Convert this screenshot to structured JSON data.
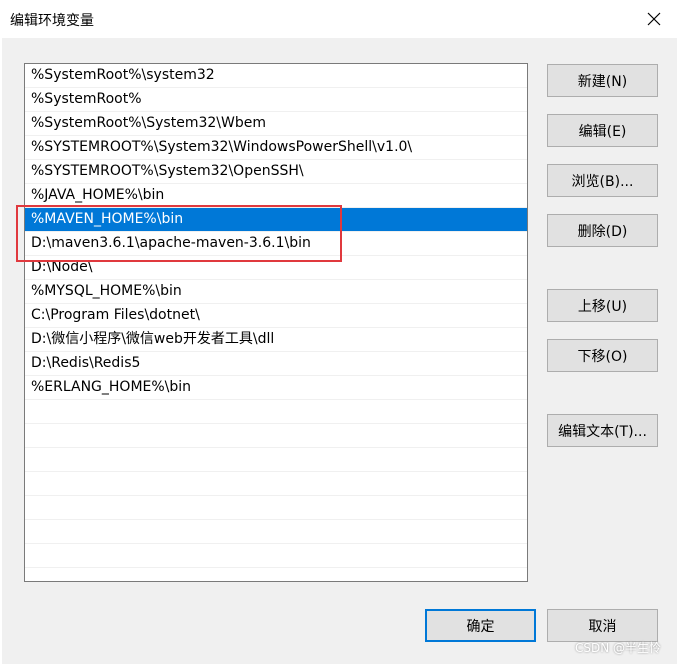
{
  "window": {
    "title": "编辑环境变量"
  },
  "paths": [
    "%SystemRoot%\\system32",
    "%SystemRoot%",
    "%SystemRoot%\\System32\\Wbem",
    "%SYSTEMROOT%\\System32\\WindowsPowerShell\\v1.0\\",
    "%SYSTEMROOT%\\System32\\OpenSSH\\",
    "%JAVA_HOME%\\bin",
    "%MAVEN_HOME%\\bin",
    "D:\\maven3.6.1\\apache-maven-3.6.1\\bin",
    "D:\\Node\\",
    "%MYSQL_HOME%\\bin",
    "C:\\Program Files\\dotnet\\",
    "D:\\微信小程序\\微信web开发者工具\\dll",
    "D:\\Redis\\Redis5",
    "%ERLANG_HOME%\\bin"
  ],
  "selected_index": 6,
  "buttons": {
    "new": "新建(N)",
    "edit": "编辑(E)",
    "browse": "浏览(B)...",
    "delete": "删除(D)",
    "move_up": "上移(U)",
    "move_down": "下移(O)",
    "edit_text": "编辑文本(T)...",
    "ok": "确定",
    "cancel": "取消"
  },
  "watermark": "CSDN @半生怜",
  "colors": {
    "selection": "#0078d7",
    "highlight_border": "#e0393e"
  }
}
